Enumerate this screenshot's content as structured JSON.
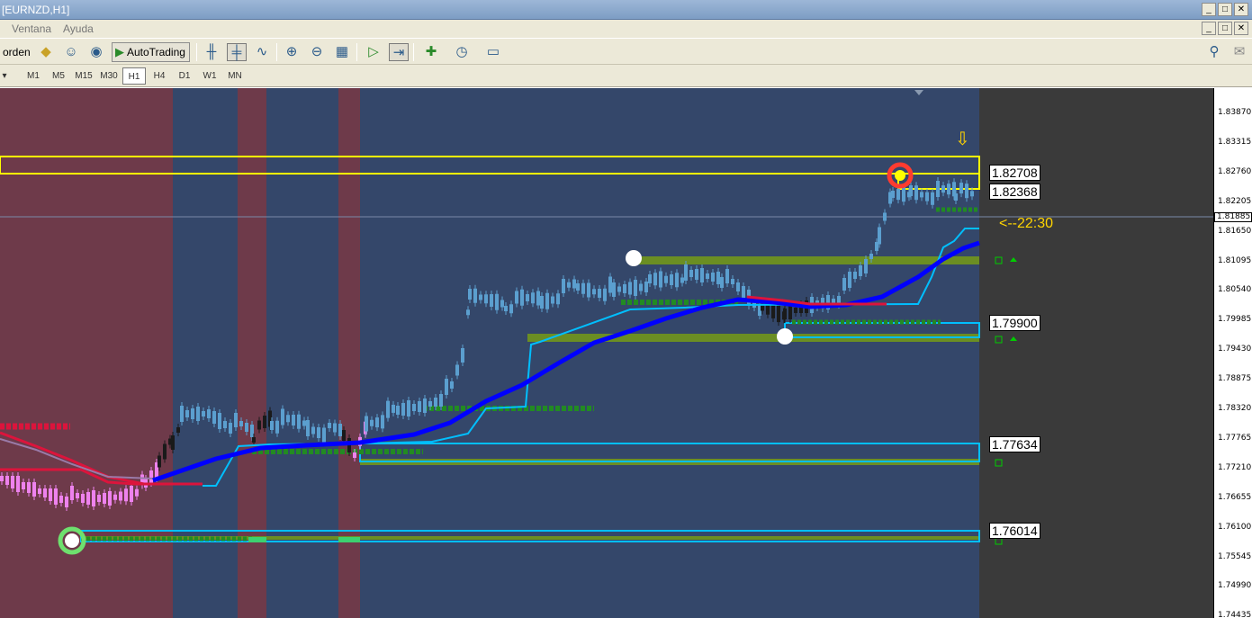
{
  "window": {
    "title": "[EURNZD,H1]",
    "buttons": [
      "_",
      "□",
      "✕"
    ]
  },
  "menu": {
    "items": [
      "Ventana",
      "Ayuda"
    ]
  },
  "toolbar": {
    "order_label": "orden",
    "autotrading_label": "AutoTrading"
  },
  "timeframes": [
    "M1",
    "M5",
    "M15",
    "M30",
    "H1",
    "H4",
    "D1",
    "W1",
    "MN"
  ],
  "active_timeframe": "H1",
  "price_scale": [
    "1.83870",
    "1.83315",
    "1.82760",
    "1.82205",
    "1.81650",
    "1.81095",
    "1.80540",
    "1.79985",
    "1.79430",
    "1.78875",
    "1.78320",
    "1.77765",
    "1.77210",
    "1.76655",
    "1.76100",
    "1.75545",
    "1.74990",
    "1.74435"
  ],
  "current_price": "1.81885",
  "level_labels": [
    "1.82708",
    "1.82368",
    "1.79900",
    "1.77634",
    "1.76014"
  ],
  "timer": "<--22:30",
  "colors": {
    "chart_bg": "#3a3a3a",
    "session_blue": "#34476a",
    "session_red": "#6e3a4a",
    "bull_candle": "#5b9fcf",
    "bear_candle": "#1a1a1a",
    "pink_candle": "#ee82ee",
    "ma_blue": "#0000ff",
    "ma_red": "#dc143c",
    "cyan": "#00bfff",
    "olive": "#6b8e23",
    "yellow": "#ffff00",
    "green_dots": "#228b22"
  },
  "chart_data": {
    "type": "candlestick",
    "symbol": "EURNZD",
    "timeframe": "H1",
    "ylim": [
      1.743,
      1.842
    ],
    "levels": [
      1.82708,
      1.82368,
      1.799,
      1.77634,
      1.76014
    ]
  }
}
